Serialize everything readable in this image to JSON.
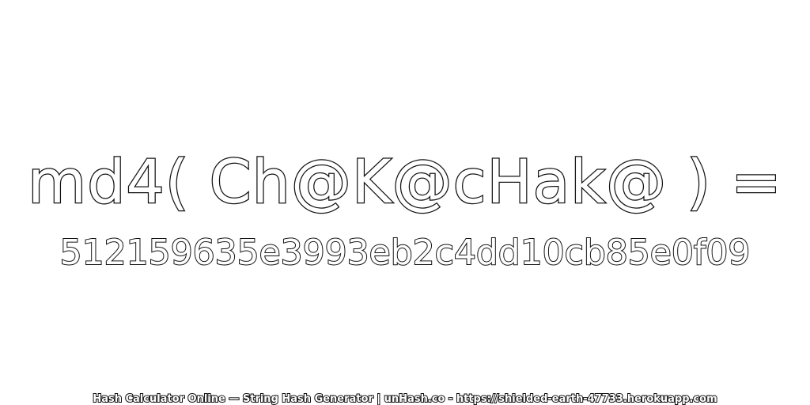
{
  "expression": "md4( Ch@K@cHak@ ) =",
  "hash_value": "512159635e3993eb2c4dd10cb85e0f09",
  "footer": "Hash Calculator Online — String Hash Generator | unHash.co - https://shielded-earth-47733.herokuapp.com",
  "colors": {
    "background": "#ffffff",
    "text_fill": "#ffffff",
    "text_outline": "#111111"
  }
}
